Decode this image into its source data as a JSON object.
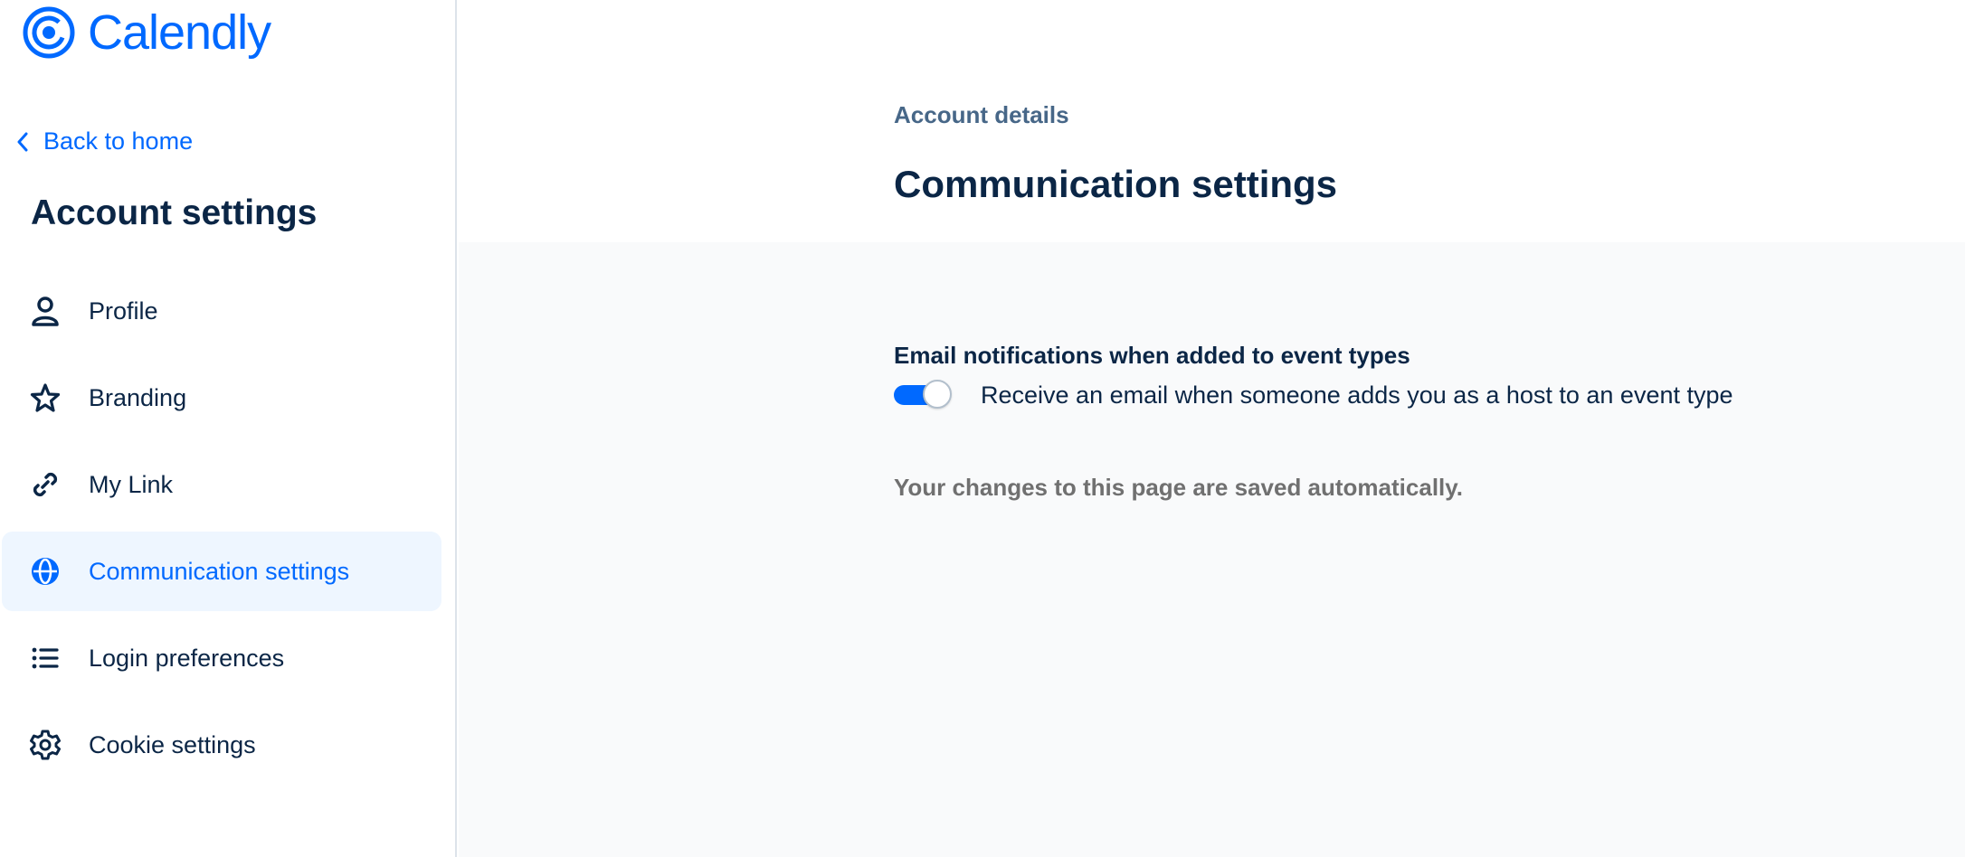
{
  "brand": {
    "name": "Calendly",
    "accent": "#0069ff"
  },
  "sidebar": {
    "back_label": "Back to home",
    "title": "Account settings",
    "items": [
      {
        "label": "Profile",
        "icon": "person-icon",
        "active": false
      },
      {
        "label": "Branding",
        "icon": "star-icon",
        "active": false
      },
      {
        "label": "My Link",
        "icon": "link-icon",
        "active": false
      },
      {
        "label": "Communication settings",
        "icon": "globe-icon",
        "active": true
      },
      {
        "label": "Login preferences",
        "icon": "list-icon",
        "active": false
      },
      {
        "label": "Cookie settings",
        "icon": "gear-icon",
        "active": false
      }
    ]
  },
  "main": {
    "breadcrumb": "Account details",
    "title": "Communication settings",
    "section": {
      "title": "Email notifications when added to event types",
      "toggle_on": true,
      "description": "Receive an email when someone adds you as a host to an event type"
    },
    "autosave_note": "Your changes to this page are saved automatically."
  }
}
